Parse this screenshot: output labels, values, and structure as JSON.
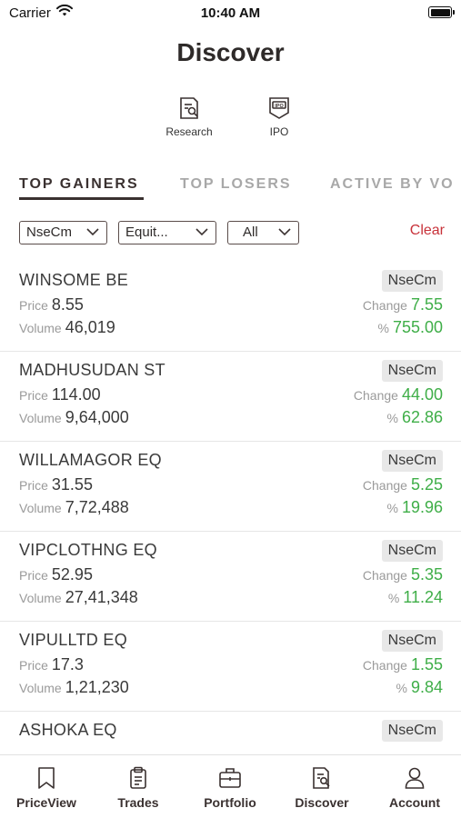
{
  "status_bar": {
    "carrier": "Carrier",
    "time": "10:40 AM"
  },
  "header": {
    "title": "Discover"
  },
  "quick_links": [
    {
      "label": "Research",
      "icon": "research-icon"
    },
    {
      "label": "IPO",
      "icon": "ipo-icon"
    }
  ],
  "tabs": [
    {
      "label": "TOP GAINERS",
      "active": true
    },
    {
      "label": "TOP LOSERS",
      "active": false
    },
    {
      "label": "ACTIVE BY VO",
      "active": false
    }
  ],
  "filters": {
    "exchange": "NseCm",
    "segment": "Equit...",
    "series": "All",
    "clear_label": "Clear"
  },
  "labels": {
    "price": "Price",
    "volume": "Volume",
    "change": "Change",
    "percent": "%"
  },
  "colors": {
    "accent": "#3a3130",
    "gain": "#3fae48",
    "clear": "#c8323a",
    "badge_bg": "#e8e8e8"
  },
  "stocks": [
    {
      "name": "WINSOME BE",
      "exchange": "NseCm",
      "price": "8.55",
      "volume": "46,019",
      "change": "7.55",
      "percent": "755.00"
    },
    {
      "name": "MADHUSUDAN ST",
      "exchange": "NseCm",
      "price": "114.00",
      "volume": "9,64,000",
      "change": "44.00",
      "percent": "62.86"
    },
    {
      "name": "WILLAMAGOR EQ",
      "exchange": "NseCm",
      "price": "31.55",
      "volume": "7,72,488",
      "change": "5.25",
      "percent": "19.96"
    },
    {
      "name": "VIPCLOTHNG EQ",
      "exchange": "NseCm",
      "price": "52.95",
      "volume": "27,41,348",
      "change": "5.35",
      "percent": "11.24"
    },
    {
      "name": "VIPULLTD EQ",
      "exchange": "NseCm",
      "price": "17.3",
      "volume": "1,21,230",
      "change": "1.55",
      "percent": "9.84"
    },
    {
      "name": "ASHOKA EQ",
      "exchange": "NseCm",
      "price": "",
      "volume": "",
      "change": "",
      "percent": ""
    }
  ],
  "bottom_nav": [
    {
      "label": "PriceView",
      "icon": "bookmark-icon"
    },
    {
      "label": "Trades",
      "icon": "clipboard-icon"
    },
    {
      "label": "Portfolio",
      "icon": "briefcase-icon"
    },
    {
      "label": "Discover",
      "icon": "discover-icon"
    },
    {
      "label": "Account",
      "icon": "person-icon"
    }
  ]
}
